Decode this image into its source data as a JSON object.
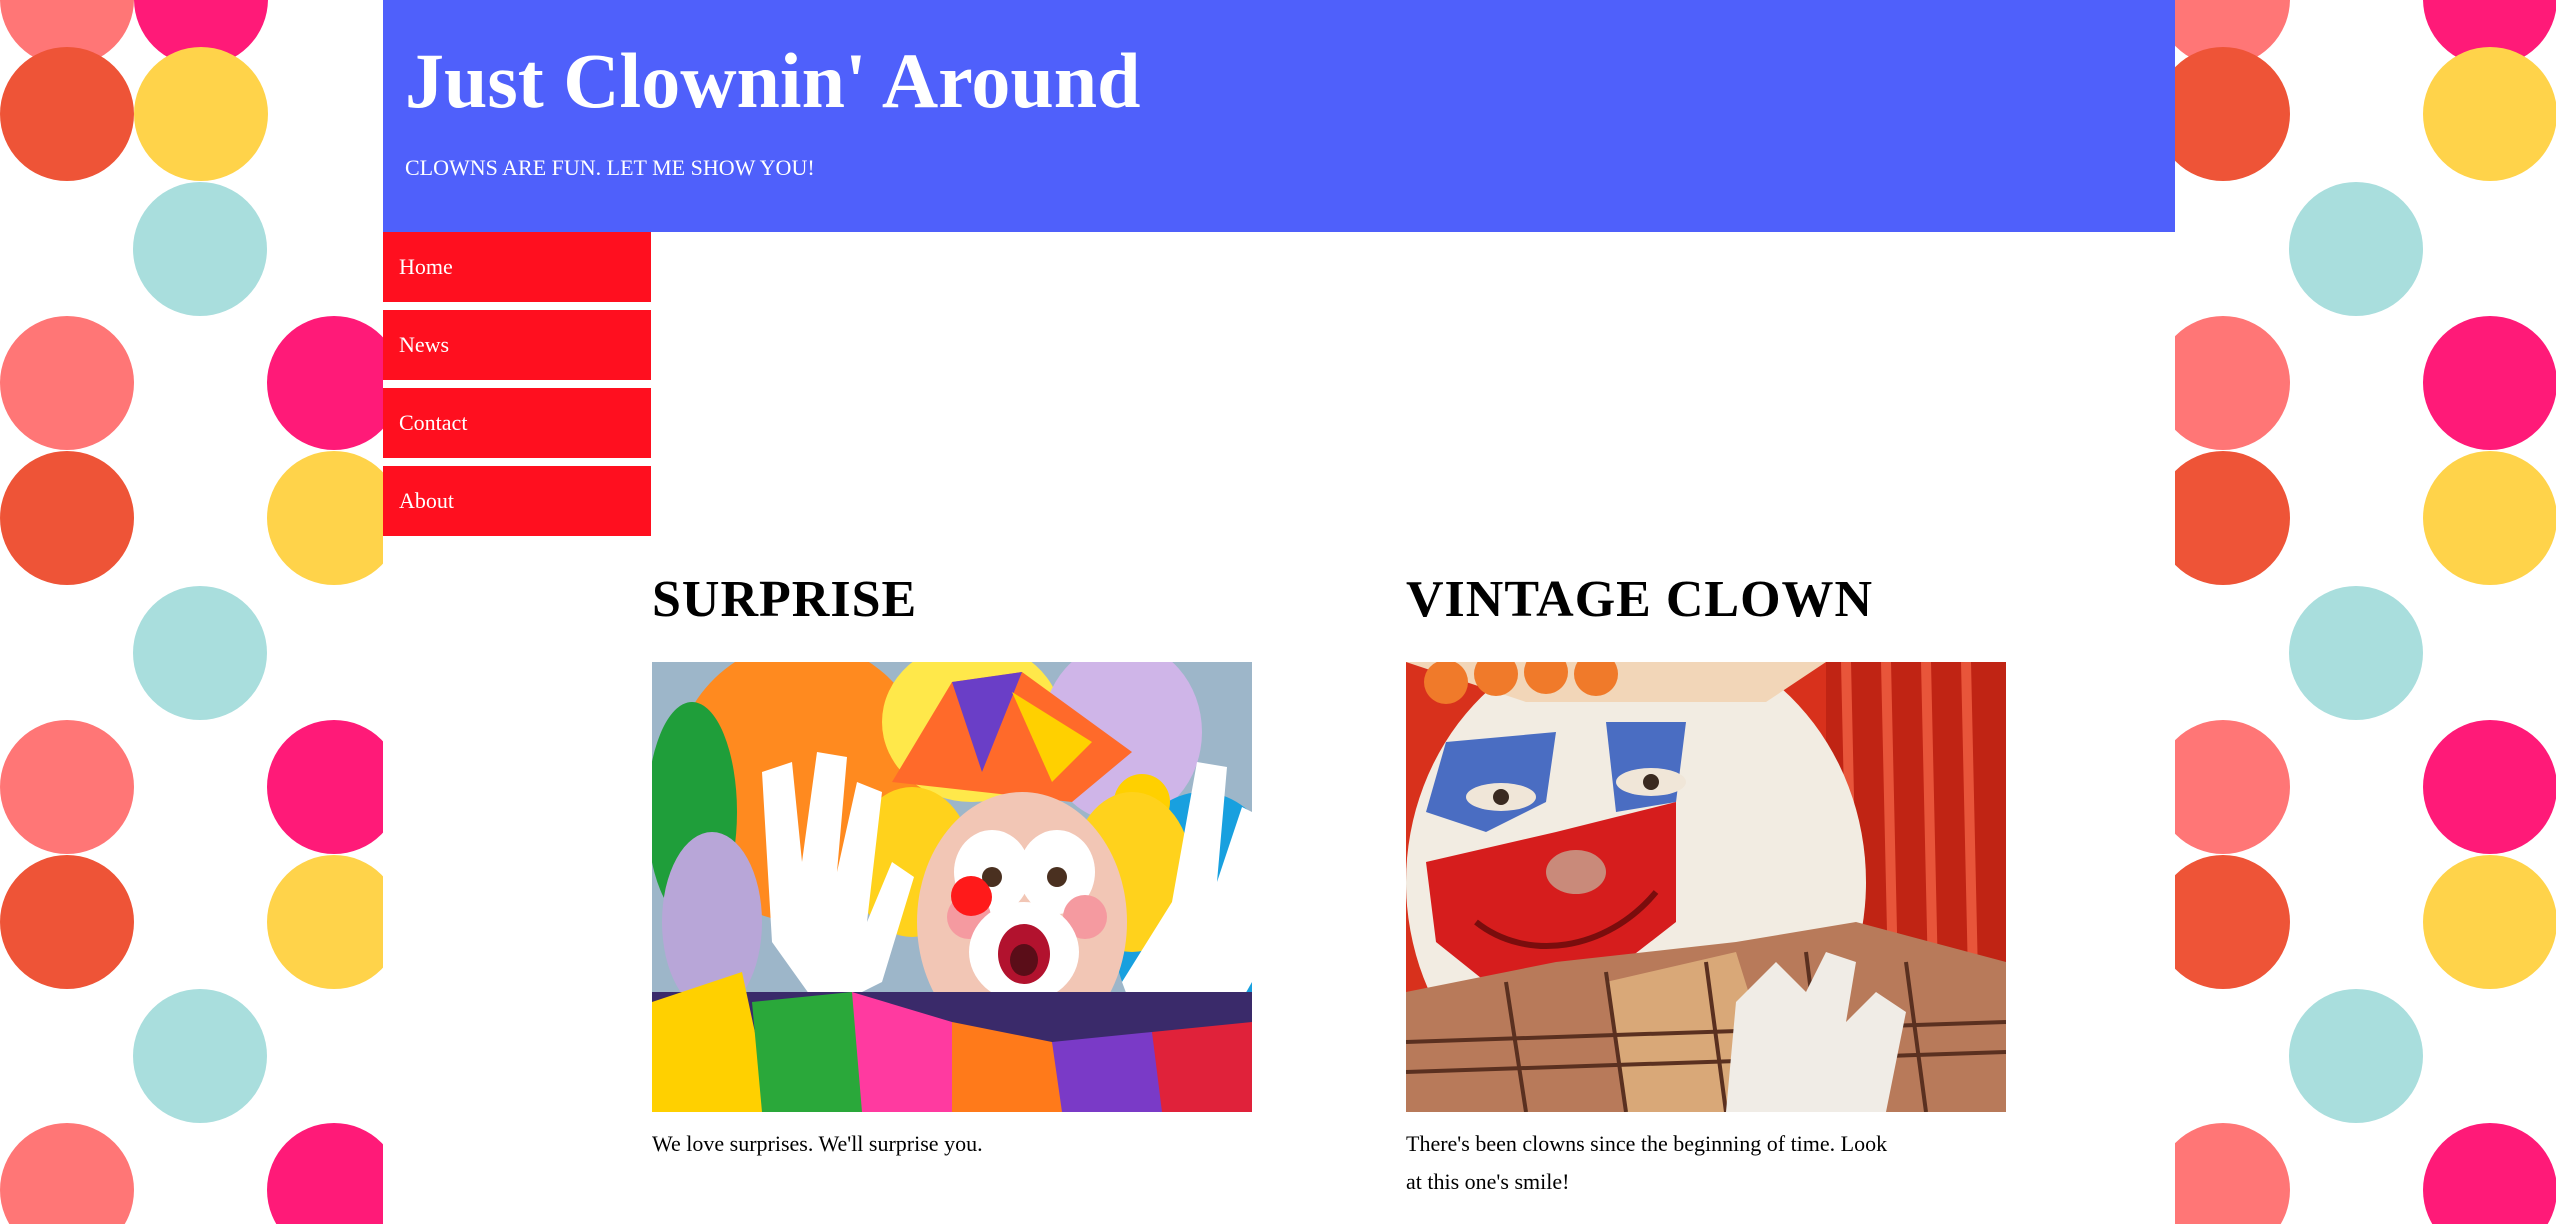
{
  "header": {
    "title": "Just Clownin' Around",
    "tagline": "CLOWNS ARE FUN. LET ME SHOW YOU!"
  },
  "nav": {
    "items": [
      {
        "label": "Home"
      },
      {
        "label": "News"
      },
      {
        "label": "Contact"
      },
      {
        "label": "About"
      }
    ]
  },
  "articles": [
    {
      "heading": "SURPRISE",
      "caption": "We love surprises. We'll surprise you.",
      "image": "surprised-clown-photo"
    },
    {
      "heading": "VINTAGE CLOWN",
      "caption": "There's been clowns since the beginning of time. Look at this one's smile!",
      "image": "vintage-clown-photo"
    }
  ],
  "colors": {
    "header_bg": "#4f60fb",
    "nav_bg": "#ff0f1f",
    "dot_salmon": "#ff7676",
    "dot_orange": "#ee5437",
    "dot_pink": "#ff1a78",
    "dot_yellow": "#ffd34a",
    "dot_teal": "#a9dedd"
  }
}
